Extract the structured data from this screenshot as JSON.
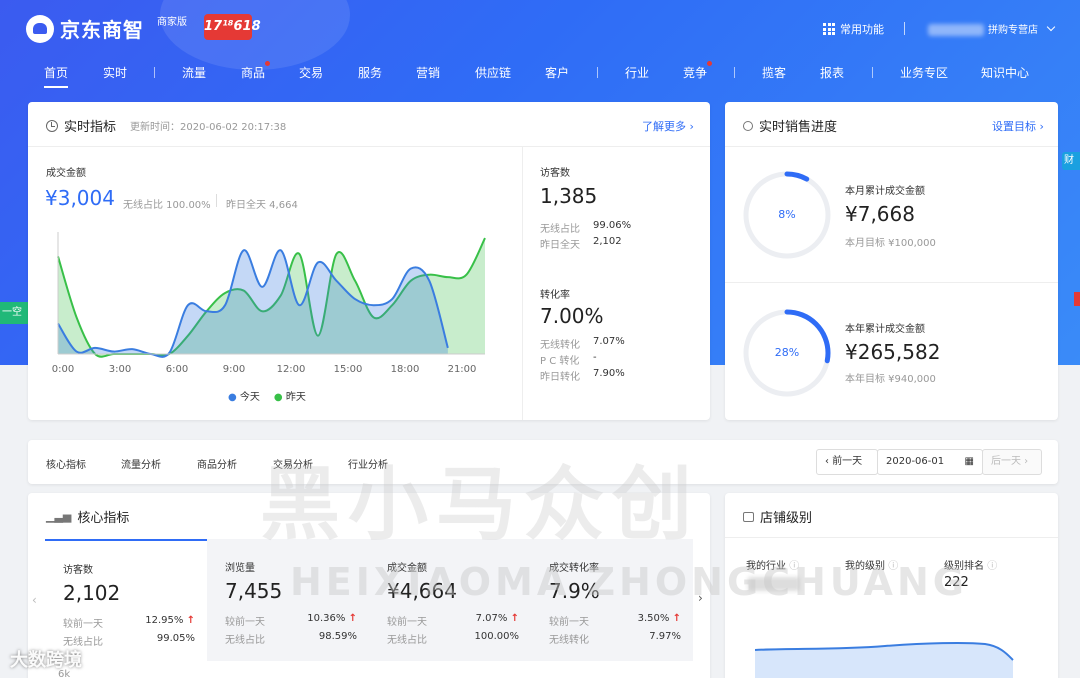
{
  "header": {
    "logo_text": "京东商智",
    "edition": "商家版",
    "promo": "17¹⁸618",
    "common_functions": "常用功能",
    "store_name": "拼购专营店"
  },
  "nav": [
    "首页",
    "实时",
    "流量",
    "商品",
    "交易",
    "服务",
    "营销",
    "供应链",
    "客户",
    "行业",
    "竞争",
    "揽客",
    "报表",
    "业务专区",
    "知识中心"
  ],
  "side": {
    "right_tab": "财",
    "left_tab": "一空"
  },
  "realtime": {
    "title": "实时指标",
    "update_time": "更新时间：2020-06-02 20:17:38",
    "learn_more": "了解更多",
    "gmv_label": "成交金额",
    "gmv_value": "¥3,004",
    "wireless_ratio": "无线占比 100.00%",
    "yesterday_all": "昨日全天 4,664",
    "x_ticks": [
      "0:00",
      "3:00",
      "6:00",
      "9:00",
      "12:00",
      "15:00",
      "18:00",
      "21:00"
    ],
    "legend_today": "今天",
    "legend_yesterday": "昨天",
    "visitors_label": "访客数",
    "visitors_value": "1,385",
    "v_wireless_label": "无线占比",
    "v_wireless_value": "99.06%",
    "v_yesterday_label": "昨日全天",
    "v_yesterday_value": "2,102",
    "conv_label": "转化率",
    "conv_value": "7.00%",
    "c_wireless_label": "无线转化",
    "c_wireless_value": "7.07%",
    "c_pc_label": "P C 转化",
    "c_pc_value": "-",
    "c_yesterday_label": "昨日转化",
    "c_yesterday_value": "7.90%"
  },
  "chart_data": {
    "type": "area",
    "x": [
      0,
      1,
      2,
      3,
      4,
      5,
      6,
      7,
      8,
      9,
      10,
      11,
      12,
      13,
      14,
      15,
      16,
      17,
      18,
      19,
      20,
      21,
      22,
      23
    ],
    "series": [
      {
        "name": "今天",
        "values": [
          25,
          2,
          5,
          2,
          4,
          0,
          1,
          40,
          35,
          40,
          85,
          55,
          85,
          40,
          75,
          60,
          45,
          40,
          45,
          70,
          60,
          5,
          null,
          null
        ],
        "color": "#3a7de0"
      },
      {
        "name": "昨天",
        "values": [
          80,
          30,
          0,
          0,
          0,
          0,
          0,
          15,
          35,
          50,
          52,
          35,
          48,
          82,
          15,
          82,
          60,
          30,
          40,
          60,
          65,
          63,
          65,
          95
        ],
        "color": "#38c048"
      }
    ],
    "xlabel": "",
    "ylabel": "",
    "ylim": [
      0,
      100
    ],
    "grid": false,
    "legend": "bottom"
  },
  "sales_progress": {
    "title": "实时销售进度",
    "set_target": "设置目标",
    "month": {
      "percent_label": "8%",
      "percent": 0.08,
      "label": "本月累计成交金额",
      "value": "¥7,668",
      "target": "本月目标 ¥100,000"
    },
    "year": {
      "percent_label": "28%",
      "percent": 0.28,
      "label": "本年累计成交金额",
      "value": "¥265,582",
      "target": "本年目标 ¥940,000"
    }
  },
  "tabs": [
    "核心指标",
    "流量分析",
    "商品分析",
    "交易分析",
    "行业分析"
  ],
  "date_nav": {
    "prev": "前一天",
    "date": "2020-06-01",
    "next": "后一天"
  },
  "core": {
    "title": "核心指标",
    "metrics": [
      {
        "label": "访客数",
        "value": "2,102",
        "r1_label": "较前一天",
        "r1_value": "12.95%",
        "r2_label": "无线占比",
        "r2_value": "99.05%"
      },
      {
        "label": "浏览量",
        "value": "7,455",
        "r1_label": "较前一天",
        "r1_value": "10.36%",
        "r2_label": "无线占比",
        "r2_value": "98.59%"
      },
      {
        "label": "成交金额",
        "value": "¥4,664",
        "r1_label": "较前一天",
        "r1_value": "7.07%",
        "r2_label": "无线占比",
        "r2_value": "100.00%"
      },
      {
        "label": "成交转化率",
        "value": "7.9%",
        "r1_label": "较前一天",
        "r1_value": "3.50%",
        "r2_label": "无线转化",
        "r2_value": "7.97%"
      }
    ],
    "y_tick": "6k"
  },
  "store_level": {
    "title": "店铺级别",
    "industry_label": "我的行业",
    "level_label": "我的级别",
    "rank_label": "级别排名",
    "rank_value": "222"
  },
  "watermark": {
    "cn": "黑小马众创",
    "en": "HEIXIAOMA ZHONGCHUANG",
    "corner": "大数跨境"
  }
}
